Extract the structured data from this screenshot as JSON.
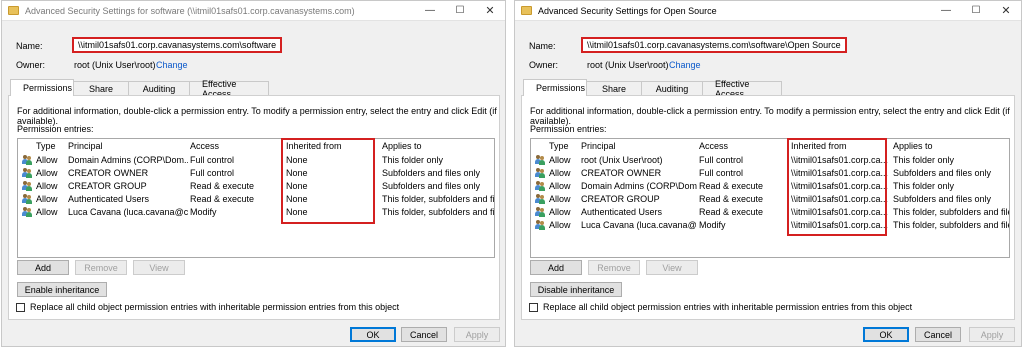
{
  "left": {
    "title": "Advanced Security Settings for software (\\\\itmil01safs01.corp.cavanasystems.com)",
    "name_label": "Name:",
    "name_value": "\\\\itmil01safs01.corp.cavanasystems.com\\software",
    "owner_label": "Owner:",
    "owner_value": "root (Unix User\\root)",
    "change_link": "Change",
    "tabs": [
      "Permissions",
      "Share",
      "Auditing",
      "Effective Access"
    ],
    "info_text": "For additional information, double-click a permission entry. To modify a permission entry, select the entry and click Edit (if available).",
    "entries_label": "Permission entries:",
    "columns": [
      "Type",
      "Principal",
      "Access",
      "Inherited from",
      "Applies to"
    ],
    "rows": [
      {
        "type": "Allow",
        "principal": "Domain Admins (CORP\\Dom...",
        "access": "Full control",
        "inherited": "None",
        "applies": "This folder only"
      },
      {
        "type": "Allow",
        "principal": "CREATOR OWNER",
        "access": "Full control",
        "inherited": "None",
        "applies": "Subfolders and files only"
      },
      {
        "type": "Allow",
        "principal": "CREATOR GROUP",
        "access": "Read & execute",
        "inherited": "None",
        "applies": "Subfolders and files only"
      },
      {
        "type": "Allow",
        "principal": "Authenticated Users",
        "access": "Read & execute",
        "inherited": "None",
        "applies": "This folder, subfolders and files"
      },
      {
        "type": "Allow",
        "principal": "Luca Cavana (luca.cavana@c...",
        "access": "Modify",
        "inherited": "None",
        "applies": "This folder, subfolders and files"
      }
    ],
    "add_btn": "Add",
    "remove_btn": "Remove",
    "view_btn": "View",
    "inheritance_btn": "Enable inheritance",
    "replace_label": "Replace all child object permission entries with inheritable permission entries from this object",
    "ok_btn": "OK",
    "cancel_btn": "Cancel",
    "apply_btn": "Apply"
  },
  "right": {
    "title": "Advanced Security Settings for Open Source",
    "name_label": "Name:",
    "name_value": "\\\\itmil01safs01.corp.cavanasystems.com\\software\\Open Source",
    "owner_label": "Owner:",
    "owner_value": "root (Unix User\\root)",
    "change_link": "Change",
    "tabs": [
      "Permissions",
      "Share",
      "Auditing",
      "Effective Access"
    ],
    "info_text": "For additional information, double-click a permission entry. To modify a permission entry, select the entry and click Edit (if available).",
    "entries_label": "Permission entries:",
    "columns": [
      "Type",
      "Principal",
      "Access",
      "Inherited from",
      "Applies to"
    ],
    "rows": [
      {
        "type": "Allow",
        "principal": "root (Unix User\\root)",
        "access": "Full control",
        "inherited": "\\\\itmil01safs01.corp.ca...",
        "applies": "This folder only"
      },
      {
        "type": "Allow",
        "principal": "CREATOR OWNER",
        "access": "Full control",
        "inherited": "\\\\itmil01safs01.corp.ca...",
        "applies": "Subfolders and files only"
      },
      {
        "type": "Allow",
        "principal": "Domain Admins (CORP\\Dom...",
        "access": "Read & execute",
        "inherited": "\\\\itmil01safs01.corp.ca...",
        "applies": "This folder only"
      },
      {
        "type": "Allow",
        "principal": "CREATOR GROUP",
        "access": "Read & execute",
        "inherited": "\\\\itmil01safs01.corp.ca...",
        "applies": "Subfolders and files only"
      },
      {
        "type": "Allow",
        "principal": "Authenticated Users",
        "access": "Read & execute",
        "inherited": "\\\\itmil01safs01.corp.ca...",
        "applies": "This folder, subfolders and files"
      },
      {
        "type": "Allow",
        "principal": "Luca Cavana (luca.cavana@c...",
        "access": "Modify",
        "inherited": "\\\\itmil01safs01.corp.ca...",
        "applies": "This folder, subfolders and files"
      }
    ],
    "add_btn": "Add",
    "remove_btn": "Remove",
    "view_btn": "View",
    "inheritance_btn": "Disable inheritance",
    "replace_label": "Replace all child object permission entries with inheritable permission entries from this object",
    "ok_btn": "OK",
    "cancel_btn": "Cancel",
    "apply_btn": "Apply"
  },
  "icons": {
    "folder": "folder-icon",
    "user": "users-icon",
    "minimize": "minimize-icon",
    "maximize": "maximize-icon",
    "close": "close-icon"
  },
  "colors": {
    "highlight": "#d42020",
    "link": "#0a58ca",
    "ok_border": "#0078d7"
  }
}
